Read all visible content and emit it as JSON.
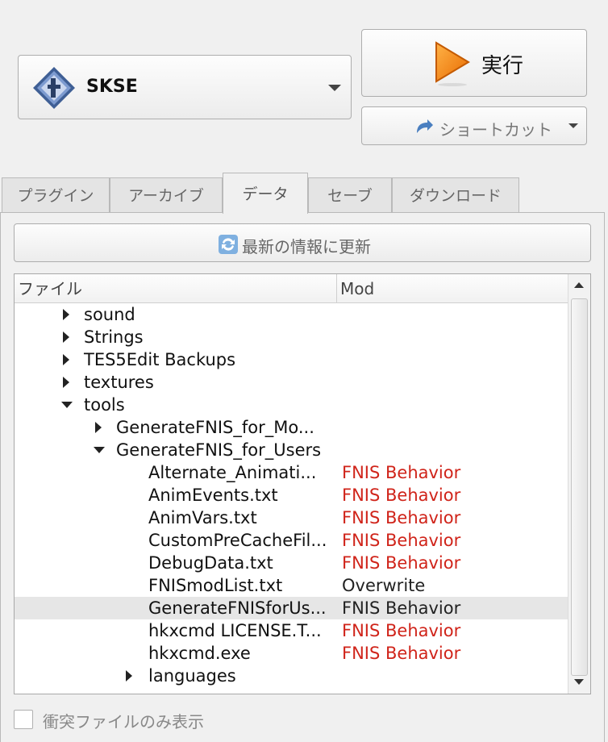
{
  "executable": {
    "selected": "SKSE",
    "icon": "skse-icon"
  },
  "run_button": {
    "label": "実行",
    "icon": "play-icon"
  },
  "shortcut_button": {
    "label": "ショートカット",
    "icon": "shortcut-arrow-icon"
  },
  "tabs": [
    {
      "label": "プラグイン"
    },
    {
      "label": "アーカイブ"
    },
    {
      "label": "データ",
      "active": true
    },
    {
      "label": "セーブ"
    },
    {
      "label": "ダウンロード"
    }
  ],
  "refresh_button": {
    "label": "最新の情報に更新",
    "icon": "refresh-icon"
  },
  "tree": {
    "columns": [
      "ファイル",
      "Mod"
    ],
    "rows": [
      {
        "name": "sound",
        "mod": "",
        "depth": 0,
        "expander": "collapsed"
      },
      {
        "name": "Strings",
        "mod": "",
        "depth": 0,
        "expander": "collapsed"
      },
      {
        "name": "TES5Edit Backups",
        "mod": "",
        "depth": 0,
        "expander": "collapsed"
      },
      {
        "name": "textures",
        "mod": "",
        "depth": 0,
        "expander": "collapsed"
      },
      {
        "name": "tools",
        "mod": "",
        "depth": 0,
        "expander": "expanded"
      },
      {
        "name": "GenerateFNIS_for_Mo...",
        "mod": "",
        "depth": 1,
        "expander": "collapsed"
      },
      {
        "name": "GenerateFNIS_for_Users",
        "mod": "",
        "depth": 1,
        "expander": "expanded"
      },
      {
        "name": "Alternate_Animati...",
        "mod": "FNIS Behavior",
        "depth": 2,
        "expander": "none",
        "conflict": true
      },
      {
        "name": "AnimEvents.txt",
        "mod": "FNIS Behavior",
        "depth": 2,
        "expander": "none",
        "conflict": true
      },
      {
        "name": "AnimVars.txt",
        "mod": "FNIS Behavior",
        "depth": 2,
        "expander": "none",
        "conflict": true
      },
      {
        "name": "CustomPreCacheFil...",
        "mod": "FNIS Behavior",
        "depth": 2,
        "expander": "none",
        "conflict": true
      },
      {
        "name": "DebugData.txt",
        "mod": "FNIS Behavior",
        "depth": 2,
        "expander": "none",
        "conflict": true
      },
      {
        "name": "FNISmodList.txt",
        "mod": "Overwrite",
        "depth": 2,
        "expander": "none",
        "conflict": false
      },
      {
        "name": "GenerateFNISforUs...",
        "mod": "FNIS Behavior",
        "depth": 2,
        "expander": "none",
        "conflict": false,
        "selected": true
      },
      {
        "name": "hkxcmd LICENSE.T...",
        "mod": "FNIS Behavior",
        "depth": 2,
        "expander": "none",
        "conflict": true
      },
      {
        "name": "hkxcmd.exe",
        "mod": "FNIS Behavior",
        "depth": 2,
        "expander": "none",
        "conflict": true
      },
      {
        "name": "languages",
        "mod": "",
        "depth": 2,
        "expander": "collapsed"
      }
    ]
  },
  "conflict_filter": {
    "label": "衝突ファイルのみ表示",
    "checked": false
  },
  "colors": {
    "conflict_text": "#d0241a",
    "selected_row": "#e6e6e6"
  }
}
